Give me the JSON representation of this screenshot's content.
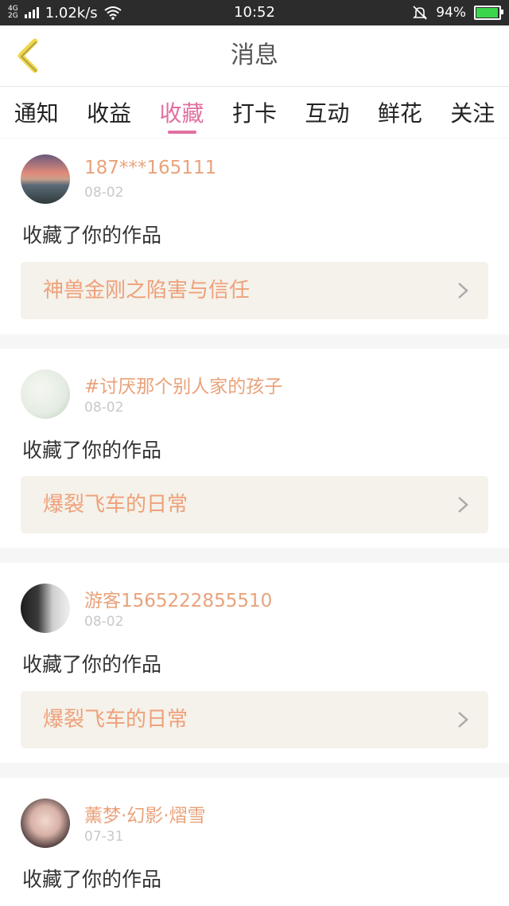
{
  "status_bar": {
    "network_top": "4G",
    "network_bottom": "2G",
    "speed": "1.02k/s",
    "time": "10:52",
    "battery": "94%"
  },
  "header": {
    "title": "消息"
  },
  "tabs": [
    {
      "label": "通知",
      "active": false
    },
    {
      "label": "收益",
      "active": false
    },
    {
      "label": "收藏",
      "active": true
    },
    {
      "label": "打卡",
      "active": false
    },
    {
      "label": "互动",
      "active": false
    },
    {
      "label": "鲜花",
      "active": false
    },
    {
      "label": "关注",
      "active": false
    }
  ],
  "accent_color": "#e26fa0",
  "messages": [
    {
      "user": "187***165111",
      "date": "08-02",
      "action": "收藏了你的作品",
      "work": "神兽金刚之陷害与信任"
    },
    {
      "user": "#讨厌那个别人家的孩子",
      "date": "08-02",
      "action": "收藏了你的作品",
      "work": "爆裂飞车的日常"
    },
    {
      "user": "游客1565222855510",
      "date": "08-02",
      "action": "收藏了你的作品",
      "work": "爆裂飞车的日常"
    },
    {
      "user": "薰梦·幻影·熠雪",
      "date": "07-31",
      "action": "收藏了你的作品"
    }
  ]
}
